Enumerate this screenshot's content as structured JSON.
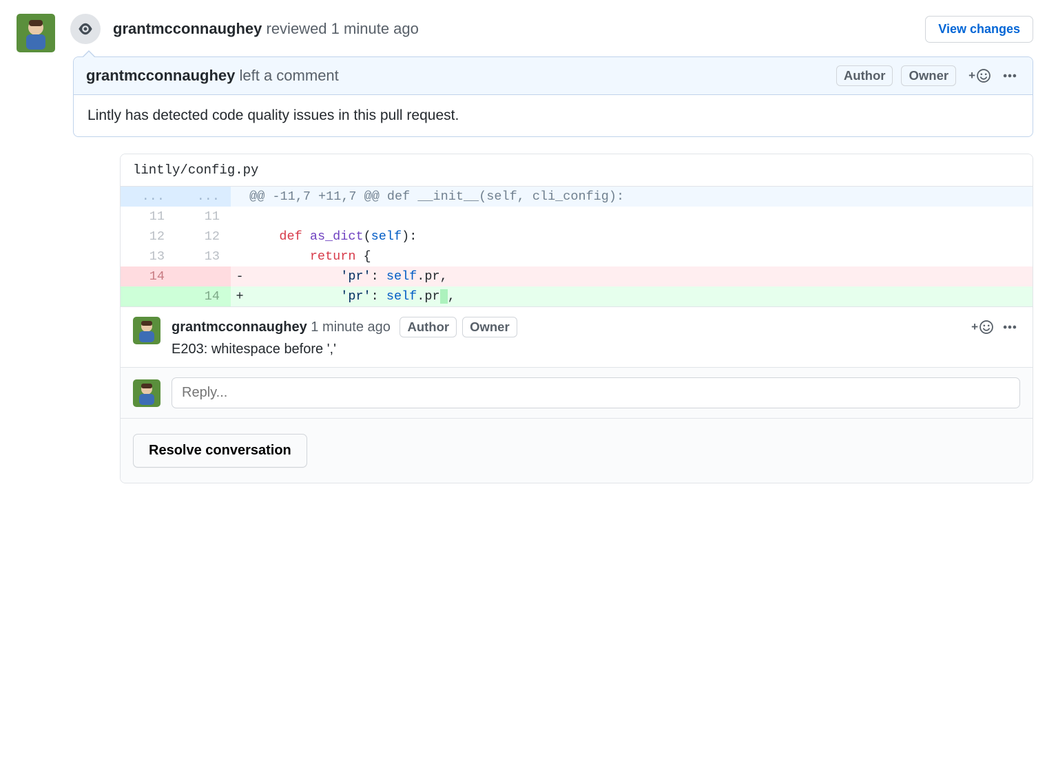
{
  "review": {
    "reviewer": "grantmcconnaughey",
    "action": "reviewed",
    "time": "1 minute ago",
    "view_changes_label": "View changes"
  },
  "top_comment": {
    "author": "grantmcconnaughey",
    "action": "left a comment",
    "author_badge": "Author",
    "owner_badge": "Owner",
    "body": "Lintly has detected code quality issues in this pull request."
  },
  "diff": {
    "filename": "lintly/config.py",
    "hunk_header": "@@ -11,7 +11,7 @@ def __init__(self, cli_config):",
    "lines": [
      {
        "old": "11",
        "new": "11",
        "type": "ctx",
        "sign": " ",
        "indent": "",
        "tokens": []
      },
      {
        "old": "12",
        "new": "12",
        "type": "ctx",
        "sign": " ",
        "indent": "    ",
        "tokens": [
          [
            "red",
            "def "
          ],
          [
            "purple",
            "as_dict"
          ],
          [
            "plain",
            "("
          ],
          [
            "blue",
            "self"
          ],
          [
            "plain",
            "):"
          ]
        ]
      },
      {
        "old": "13",
        "new": "13",
        "type": "ctx",
        "sign": " ",
        "indent": "        ",
        "tokens": [
          [
            "red",
            "return"
          ],
          [
            "plain",
            " {"
          ]
        ]
      },
      {
        "old": "14",
        "new": "",
        "type": "del",
        "sign": "-",
        "indent": "            ",
        "tokens": [
          [
            "navy",
            "'pr'"
          ],
          [
            "plain",
            ": "
          ],
          [
            "blue",
            "self"
          ],
          [
            "plain",
            ".pr,"
          ]
        ]
      },
      {
        "old": "",
        "new": "14",
        "type": "add",
        "sign": "+",
        "indent": "            ",
        "tokens": [
          [
            "navy",
            "'pr'"
          ],
          [
            "plain",
            ": "
          ],
          [
            "blue",
            "self"
          ],
          [
            "plain",
            ".pr"
          ],
          [
            "hl",
            " "
          ],
          [
            "plain",
            ","
          ]
        ]
      }
    ]
  },
  "line_comment": {
    "author": "grantmcconnaughey",
    "time": "1 minute ago",
    "author_badge": "Author",
    "owner_badge": "Owner",
    "body": "E203: whitespace before ','"
  },
  "reply": {
    "placeholder": "Reply..."
  },
  "footer": {
    "resolve_label": "Resolve conversation"
  }
}
